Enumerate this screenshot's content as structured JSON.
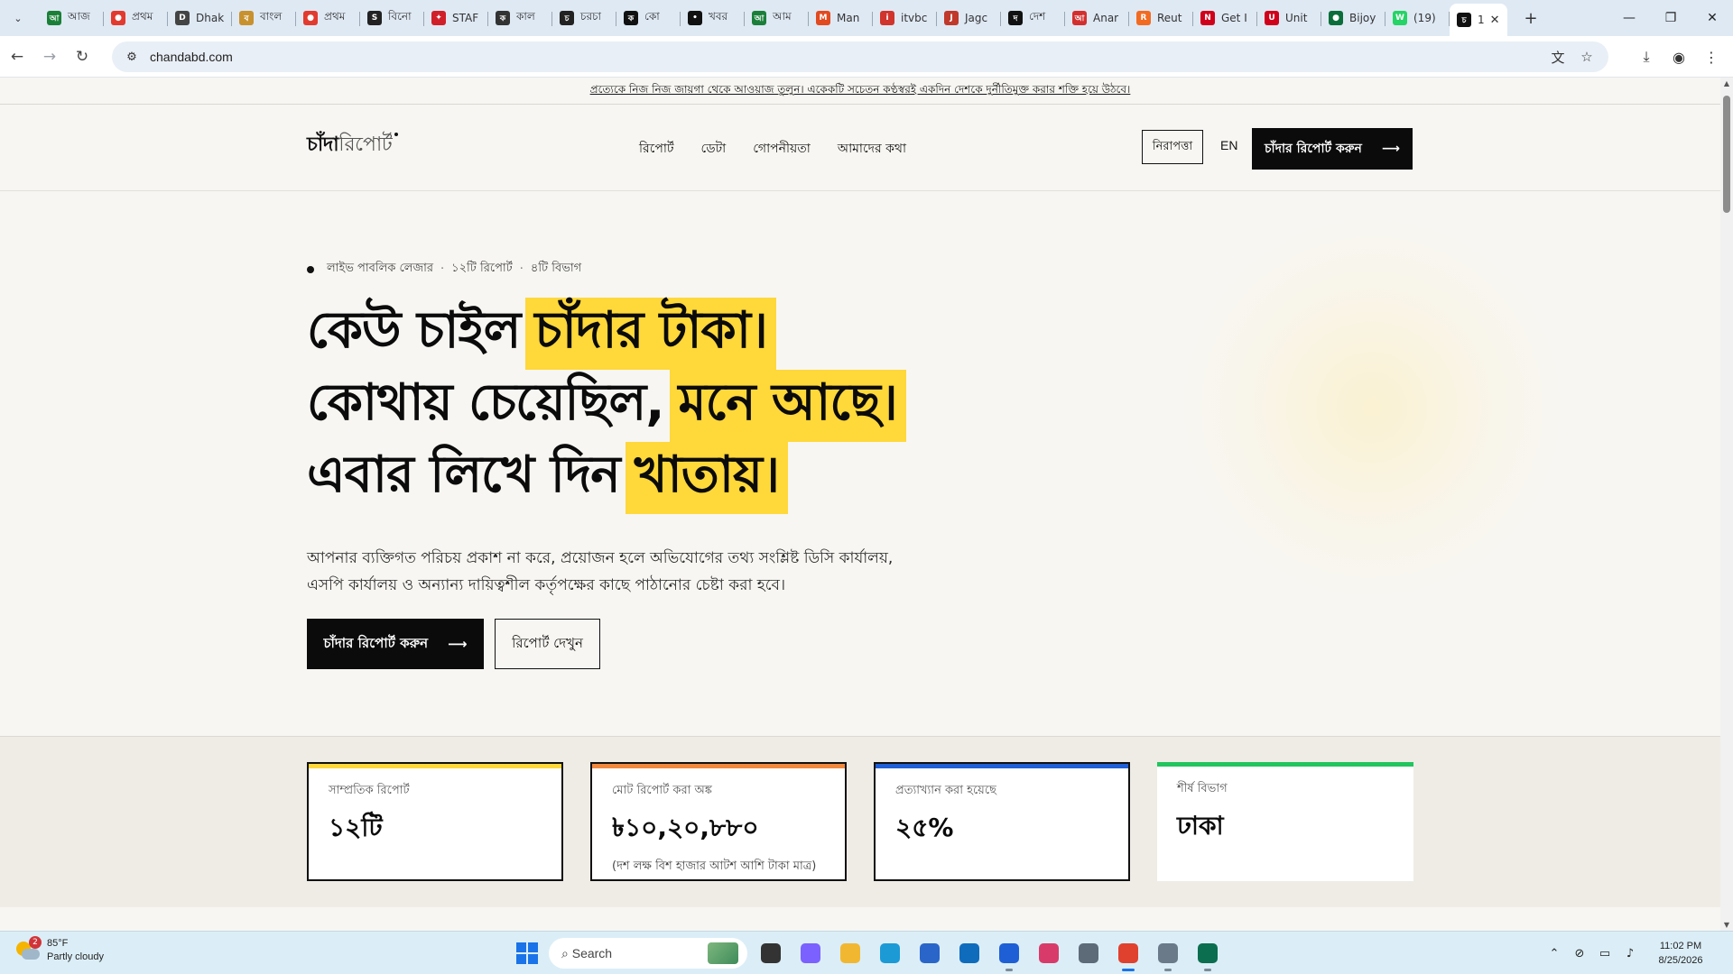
{
  "browser": {
    "tabs": [
      {
        "title": "আজ",
        "favicon_color": "#1a7f37",
        "favicon_glyph": "আ"
      },
      {
        "title": "প্রথম",
        "favicon_color": "#e23a2e",
        "favicon_glyph": "●"
      },
      {
        "title": "Dhak",
        "favicon_color": "#444444",
        "favicon_glyph": "D"
      },
      {
        "title": "বাংল",
        "favicon_color": "#c8912e",
        "favicon_glyph": "ব"
      },
      {
        "title": "প্রথম",
        "favicon_color": "#e23a2e",
        "favicon_glyph": "●"
      },
      {
        "title": "বিনো",
        "favicon_color": "#222222",
        "favicon_glyph": "S"
      },
      {
        "title": "STAF",
        "favicon_color": "#d11f2a",
        "favicon_glyph": "✦"
      },
      {
        "title": "কাল",
        "favicon_color": "#333333",
        "favicon_glyph": "ক"
      },
      {
        "title": "চরচা",
        "favicon_color": "#222222",
        "favicon_glyph": "চ"
      },
      {
        "title": "কাে",
        "favicon_color": "#111111",
        "favicon_glyph": "ক"
      },
      {
        "title": "খবর",
        "favicon_color": "#111111",
        "favicon_glyph": "•"
      },
      {
        "title": "আম",
        "favicon_color": "#1b7f3a",
        "favicon_glyph": "আ"
      },
      {
        "title": "Man",
        "favicon_color": "#e24a1f",
        "favicon_glyph": "M"
      },
      {
        "title": "itvbc",
        "favicon_color": "#d0342c",
        "favicon_glyph": "i"
      },
      {
        "title": "Jagc",
        "favicon_color": "#c0392b",
        "favicon_glyph": "J"
      },
      {
        "title": "দেশ",
        "favicon_color": "#111111",
        "favicon_glyph": "দ"
      },
      {
        "title": "Anar",
        "favicon_color": "#d32f2f",
        "favicon_glyph": "আ"
      },
      {
        "title": "Reut",
        "favicon_color": "#f26b21",
        "favicon_glyph": "R"
      },
      {
        "title": "Get I",
        "favicon_color": "#d0021b",
        "favicon_glyph": "N"
      },
      {
        "title": "Unit",
        "favicon_color": "#d0021b",
        "favicon_glyph": "U"
      },
      {
        "title": "Bijoy",
        "favicon_color": "#0a6e3a",
        "favicon_glyph": "●"
      },
      {
        "title": "(19)",
        "favicon_color": "#25d366",
        "favicon_glyph": "W"
      }
    ],
    "active_tab": {
      "title": "1",
      "favicon_color": "#111111",
      "favicon_glyph": "চ"
    },
    "url": "chandabd.com"
  },
  "site": {
    "banner": "প্রত্যেকে নিজ নিজ জায়গা থেকে আওয়াজ তুলুন। একেকটি সচেতন কণ্ঠস্বরই একদিন দেশকে দুর্নীতিমুক্ত করার শক্তি হয়ে উঠবে।",
    "logo_bold": "চাঁদা",
    "logo_light": "রিপোর্ট",
    "nav": [
      "রিপোর্ট",
      "ডেটা",
      "গোপনীয়তা",
      "আমাদের কথা"
    ],
    "safety_label": "নিরাপত্তা",
    "lang_label": "EN",
    "report_cta": "চাঁদার রিপোর্ট করুন",
    "arrow": "⟶"
  },
  "hero": {
    "meta": [
      "লাইভ পাবলিক লেজার",
      "১২টি রিপোর্ট",
      "৪টি বিভাগ"
    ],
    "meta_sep": "·",
    "line1": {
      "plain": "কেউ চাইল",
      "mark": "চাঁদার টাকা।"
    },
    "line2": {
      "plain": "কোথায় চেয়েছিল,",
      "mark": "মনে আছে।"
    },
    "line3": {
      "plain": "এবার লিখে দিন",
      "mark": "খাতায়।"
    },
    "lede": "আপনার ব্যক্তিগত পরিচয় প্রকাশ না করে, প্রয়োজন হলে অভিযোগের তথ্য সংশ্লিষ্ট ডিসি কার্যালয়, এসপি কার্যালয় ও অন্যান্য দায়িত্বশীল কর্তৃপক্ষের কাছে পাঠানোর চেষ্টা করা হবে।",
    "primary_cta": "চাঁদার রিপোর্ট করুন",
    "secondary_cta": "রিপোর্ট দেখুন",
    "highlight_color": "#ffd83a"
  },
  "stats": [
    {
      "label": "সাম্প্রতিক রিপোর্ট",
      "value": "১২টি",
      "note": "",
      "accent": "#ffd83a"
    },
    {
      "label": "মোট রিপোর্ট করা অঙ্ক",
      "value": "৳১০,২০,৮৮০",
      "note": "(দশ লক্ষ বিশ হাজার আটশ আশি টাকা মাত্র)",
      "accent": "#f0883e"
    },
    {
      "label": "প্রত্যাখ্যান করা হয়েছে",
      "value": "২৫%",
      "note": "",
      "accent": "#1f5fd6"
    },
    {
      "label": "শীর্ষ বিভাগ",
      "value": "ঢাকা",
      "note": "",
      "accent": "#22c55e"
    }
  ],
  "taskbar": {
    "weather_temp": "85°F",
    "weather_desc": "Partly cloudy",
    "weather_badge": "2",
    "search_placeholder": "Search",
    "apps": [
      {
        "name": "file-explorer-dark",
        "color": "#333333",
        "running": false
      },
      {
        "name": "copilot",
        "color": "#7b61ff",
        "running": false
      },
      {
        "name": "folder",
        "color": "#f2b731",
        "running": false
      },
      {
        "name": "edge",
        "color": "#1c9ad6",
        "running": false
      },
      {
        "name": "store",
        "color": "#2a66c9",
        "running": false
      },
      {
        "name": "outlook",
        "color": "#0f6cbd",
        "running": false
      },
      {
        "name": "notepad",
        "color": "#1f5fd6",
        "running": true
      },
      {
        "name": "snipping-tool",
        "color": "#d83b6a",
        "running": false
      },
      {
        "name": "calculator",
        "color": "#5d6b78",
        "running": false
      },
      {
        "name": "chrome",
        "color": "#e0412f",
        "running": true,
        "active": true
      },
      {
        "name": "app-window",
        "color": "#6a7a88",
        "running": true
      },
      {
        "name": "green-app",
        "color": "#0b6e4f",
        "running": true
      }
    ],
    "time": "11:02 PM",
    "date": "8/25/2026"
  }
}
